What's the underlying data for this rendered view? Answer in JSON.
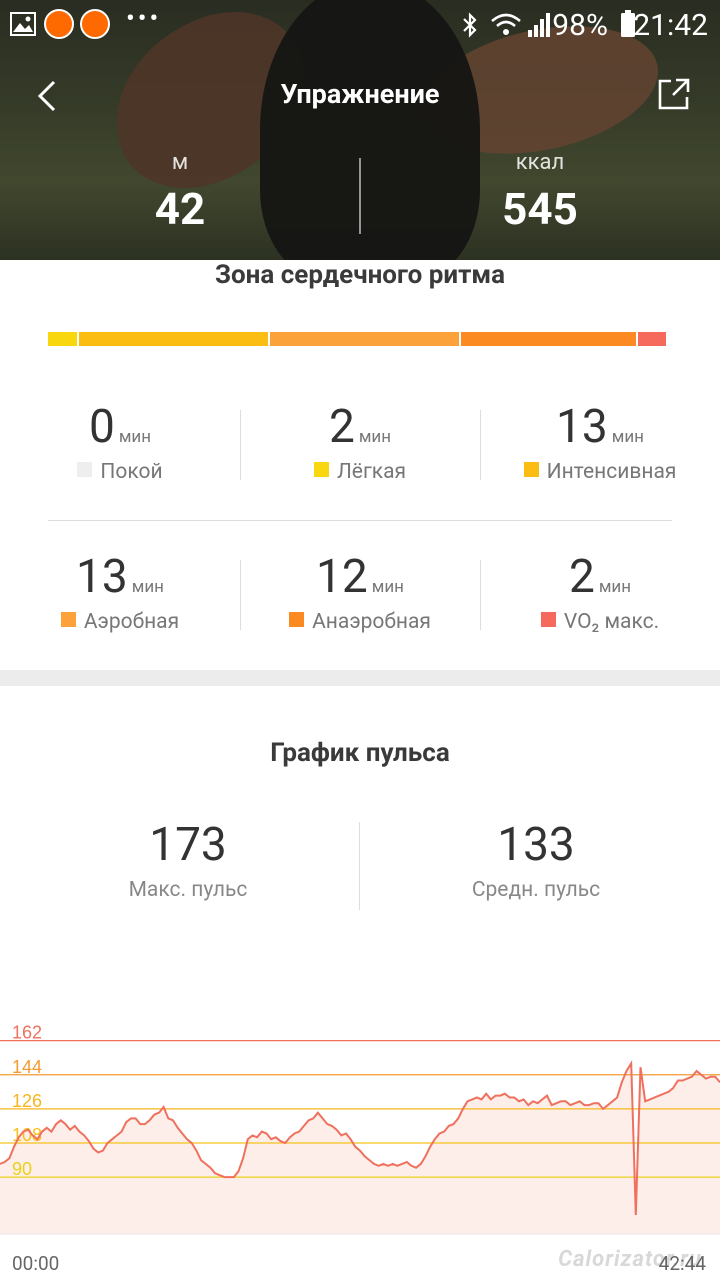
{
  "status_bar": {
    "battery": "98%",
    "time": "21:42"
  },
  "header": {
    "title": "Упражнение"
  },
  "summary": [
    {
      "unit": "м",
      "value": "42"
    },
    {
      "unit": "ккал",
      "value": "545"
    }
  ],
  "zones": {
    "title": "Зона сердечного ритма",
    "unit": "мин",
    "items": [
      {
        "value": "0",
        "label": "Покой",
        "color": "#eeeeee"
      },
      {
        "value": "2",
        "label": "Лёгкая",
        "color": "#f9d70f"
      },
      {
        "value": "13",
        "label": "Интенсивная",
        "color": "#fbbd12"
      },
      {
        "value": "13",
        "label": "Аэробная",
        "color": "#fca23a"
      },
      {
        "value": "12",
        "label": "Анаэробная",
        "color": "#fc8a23"
      },
      {
        "value": "2",
        "label": "VO₂ макс.",
        "color": "#f66a5e"
      }
    ]
  },
  "pulse": {
    "title": "График пульса",
    "max_value": "173",
    "max_label": "Макс. пульс",
    "avg_value": "133",
    "avg_label": "Средн. пульс"
  },
  "chart_data": {
    "type": "line",
    "y_thresholds": [
      {
        "label": "162",
        "color": "#f0705e"
      },
      {
        "label": "144",
        "color": "#f39a30"
      },
      {
        "label": "126",
        "color": "#f7b51c"
      },
      {
        "label": "108",
        "color": "#f7c21a"
      },
      {
        "label": "90",
        "color": "#e9d21a"
      }
    ],
    "x_start": "00:00",
    "x_end": "42:44",
    "ylim": [
      60,
      175
    ],
    "series": [
      {
        "color": "#f0705e",
        "values": [
          97,
          98,
          100,
          106,
          111,
          114,
          115,
          112,
          110,
          114,
          116,
          114,
          118,
          120,
          118,
          115,
          117,
          114,
          112,
          109,
          105,
          103,
          104,
          108,
          110,
          112,
          114,
          119,
          121,
          121,
          118,
          118,
          120,
          123,
          124,
          127,
          121,
          120,
          116,
          113,
          110,
          108,
          104,
          99,
          97,
          95,
          92,
          91,
          90,
          90,
          90,
          93,
          100,
          110,
          112,
          111,
          114,
          113,
          110,
          111,
          109,
          108,
          111,
          113,
          114,
          117,
          120,
          121,
          124,
          121,
          118,
          117,
          115,
          112,
          113,
          110,
          106,
          104,
          101,
          99,
          97,
          96,
          97,
          96,
          97,
          96,
          97,
          98,
          96,
          95,
          97,
          101,
          106,
          110,
          113,
          114,
          117,
          118,
          121,
          126,
          130,
          131,
          132,
          131,
          134,
          131,
          133,
          133,
          134,
          132,
          132,
          130,
          131,
          128,
          130,
          129,
          131,
          133,
          128,
          129,
          130,
          130,
          128,
          129,
          130,
          128,
          128,
          129,
          129,
          126,
          128,
          130,
          132,
          140,
          146,
          150,
          70,
          148,
          130,
          131,
          132,
          133,
          134,
          135,
          137,
          141,
          141,
          142,
          143,
          146,
          144,
          142,
          143,
          143,
          140
        ]
      }
    ]
  }
}
